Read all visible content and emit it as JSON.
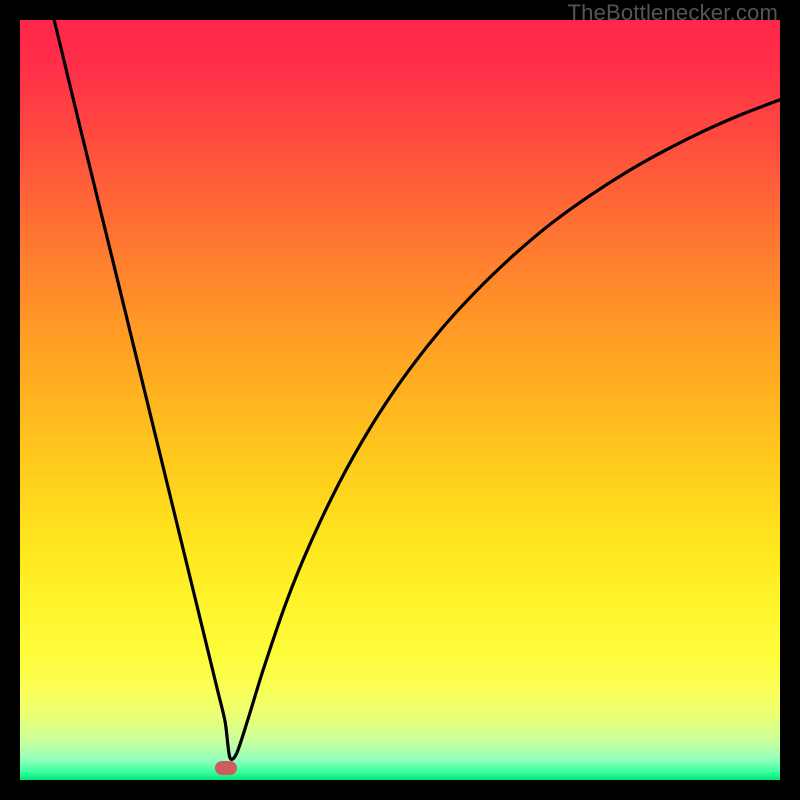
{
  "attribution": "TheBottlenecker.com",
  "chart_data": {
    "type": "line",
    "title": "",
    "xlabel": "",
    "ylabel": "",
    "xlim": [
      0,
      100
    ],
    "ylim": [
      0,
      100
    ],
    "series": [
      {
        "name": "curve",
        "x": [
          4.5,
          8,
          12,
          16,
          20,
          24,
          26,
          27,
          27.6,
          28.5,
          30,
          32,
          35,
          38,
          42,
          46,
          50,
          55,
          60,
          65,
          70,
          75,
          80,
          85,
          90,
          95,
          100
        ],
        "values": [
          100,
          85.5,
          69.2,
          52.8,
          36.4,
          20,
          11.8,
          7.6,
          3,
          3.5,
          8,
          14.5,
          23.3,
          30.7,
          39.1,
          46.2,
          52.3,
          58.8,
          64.3,
          69.1,
          73.3,
          76.9,
          80.1,
          82.9,
          85.4,
          87.6,
          89.5
        ]
      }
    ],
    "marker": {
      "x": 27.1,
      "y": 1.6
    },
    "gradient_stops": [
      {
        "pct": 0,
        "color": "#ff264a"
      },
      {
        "pct": 50,
        "color": "#ffc01e"
      },
      {
        "pct": 85,
        "color": "#fffc3a"
      },
      {
        "pct": 100,
        "color": "#00e47a"
      }
    ]
  }
}
